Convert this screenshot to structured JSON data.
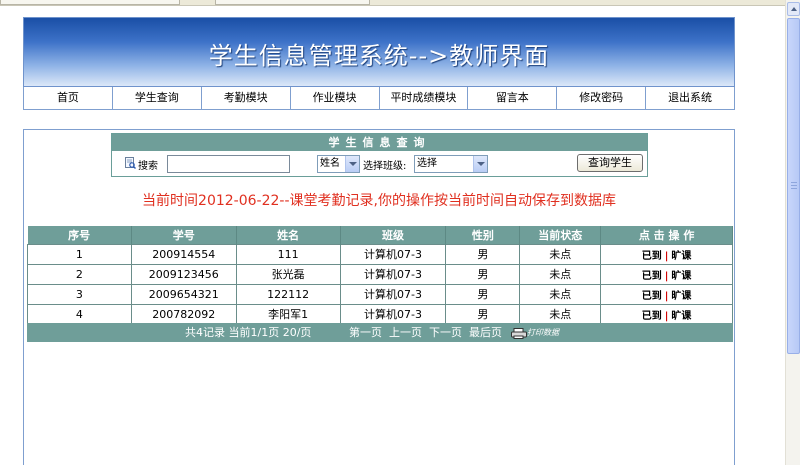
{
  "header": {
    "title": "学生信息管理系统-->教师界面"
  },
  "nav": {
    "items": [
      {
        "label": "首页"
      },
      {
        "label": "学生查询"
      },
      {
        "label": "考勤模块"
      },
      {
        "label": "作业模块"
      },
      {
        "label": "平时成绩模块"
      },
      {
        "label": "留言本"
      },
      {
        "label": "修改密码"
      },
      {
        "label": "退出系统"
      }
    ]
  },
  "query": {
    "heading": "学生信息查询",
    "search_label": "搜索",
    "search_value": "",
    "field_select": "姓名",
    "class_label": "选择班级:",
    "class_select": "选择",
    "button": "查询学生"
  },
  "notice": "当前时间2012-06-22--课堂考勤记录,你的操作按当前时间自动保存到数据库",
  "table": {
    "headers": [
      "序号",
      "学号",
      "姓名",
      "班级",
      "性别",
      "当前状态",
      "点 击 操 作"
    ],
    "rows": [
      {
        "no": "1",
        "id": "200914554",
        "name": "111",
        "class": "计算机07-3",
        "gender": "男",
        "status": "未点",
        "op1": "已到",
        "op2": "旷课"
      },
      {
        "no": "2",
        "id": "2009123456",
        "name": "张光磊",
        "class": "计算机07-3",
        "gender": "男",
        "status": "未点",
        "op1": "已到",
        "op2": "旷课"
      },
      {
        "no": "3",
        "id": "2009654321",
        "name": "122112",
        "class": "计算机07-3",
        "gender": "男",
        "status": "未点",
        "op1": "已到",
        "op2": "旷课"
      },
      {
        "no": "4",
        "id": "200782092",
        "name": "李阳军1",
        "class": "计算机07-3",
        "gender": "男",
        "status": "未点",
        "op1": "已到",
        "op2": "旷课"
      }
    ],
    "separator": "|"
  },
  "pager": {
    "summary": "共4记录  当前1/1页  20/页",
    "first": "第一页",
    "prev": "上一页",
    "next": "下一页",
    "last": "最后页",
    "print": "打印数据"
  },
  "colors": {
    "banner": "#3d72c8",
    "table_header": "#6f9e99",
    "notice": "#e03020"
  },
  "icons": {
    "search": "search-icon",
    "print": "printer-icon"
  }
}
